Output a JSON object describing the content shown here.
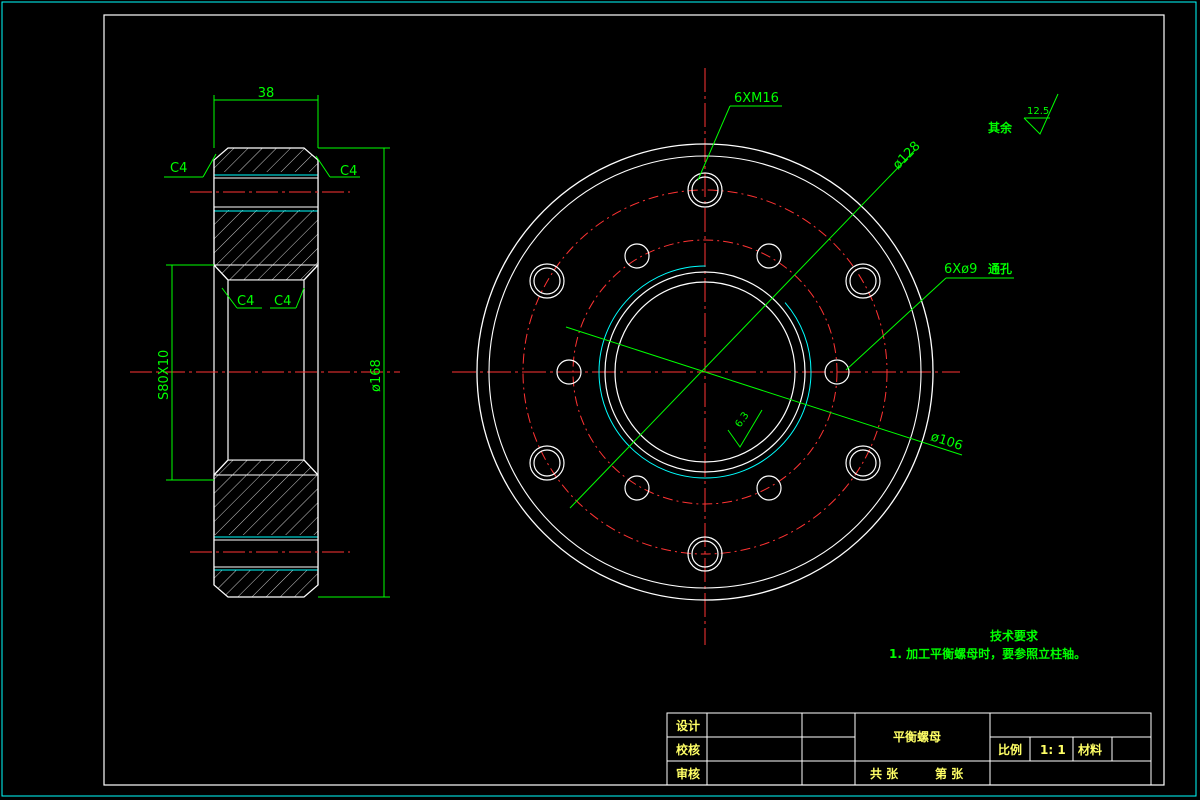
{
  "colors": {
    "frame": "#ffffff",
    "outer_border": "#00ffff",
    "dimension": "#00ff00",
    "centerline": "#ff3333",
    "hatch": "#ffffff",
    "thread": "#00ffff",
    "title_text": "#ffff66"
  },
  "side_view": {
    "width_dim": "38",
    "chamfer_top_left": "C4",
    "chamfer_top_right": "C4",
    "chamfer_inner_left": "C4",
    "chamfer_inner_right": "C4",
    "bore_dim": "S80X10",
    "outer_dim": "ø168"
  },
  "front_view": {
    "tapped_holes": "6XM16",
    "bolt_circle": "ø128",
    "through_holes": "6Xø9",
    "through_holes_suffix": "通孔",
    "inner_circle": "ø106",
    "roughness_local": "6.3"
  },
  "roughness_note": {
    "label": "其余",
    "value": "12.5"
  },
  "technical_requirements": {
    "heading": "技术要求",
    "item_1": "1. 加工平衡螺母时，要参照立柱轴。"
  },
  "title_block": {
    "design": "设计",
    "check": "校核",
    "review": "审核",
    "part_name": "平衡螺母",
    "scale_label": "比例",
    "scale_value": "1: 1",
    "material_label": "材料",
    "sheets_total": "共  张",
    "sheet_no": "第  张"
  }
}
